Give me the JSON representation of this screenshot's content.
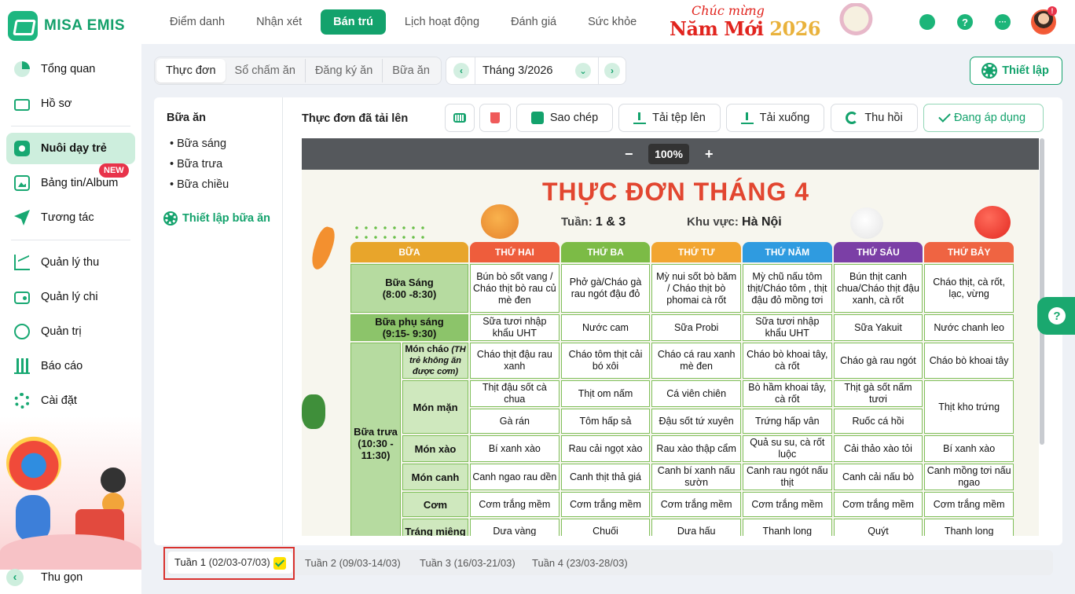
{
  "app": {
    "logo_text": "MISA EMIS"
  },
  "sidebar": {
    "items": [
      {
        "label": "Tổng quan",
        "icon": "pie-chart-icon"
      },
      {
        "label": "Hồ sơ",
        "icon": "folder-icon"
      },
      {
        "label": "Nuôi dạy trẻ",
        "icon": "house-icon",
        "active": true
      },
      {
        "label": "Bảng tin/Album",
        "icon": "image-icon",
        "badge": "NEW"
      },
      {
        "label": "Tương tác",
        "icon": "send-icon"
      },
      {
        "label": "Quản lý thu",
        "icon": "trend-chart-icon"
      },
      {
        "label": "Quản lý chi",
        "icon": "wallet-icon"
      },
      {
        "label": "Quản trị",
        "icon": "admin-icon"
      },
      {
        "label": "Báo cáo",
        "icon": "bar-chart-icon"
      },
      {
        "label": "Cài đặt",
        "icon": "gear-icon"
      }
    ],
    "collapse_label": "Thu gọn"
  },
  "topnav": {
    "tabs": [
      "Điểm danh",
      "Nhận xét",
      "Bán trú",
      "Lịch hoạt động",
      "Đánh giá",
      "Sức khỏe"
    ],
    "active_tab": "Bán trú",
    "banner_line1": "Chúc mừng",
    "banner_line2a": "Năm Mới ",
    "banner_line2b": "2026",
    "help_icon_text": "?",
    "more_icon_text": "···",
    "avatar_badge": "!"
  },
  "subtabs": [
    "Thực đơn",
    "Sổ chấm ăn",
    "Đăng ký ăn",
    "Bữa ăn"
  ],
  "month_picker": {
    "value": "Tháng 3/2026",
    "prev": "‹",
    "next": "›",
    "dropdown": "⌄"
  },
  "setup_button": "Thiết lập",
  "left_panel": {
    "title": "Bữa ăn",
    "items": [
      "• Bữa sáng",
      "• Bữa trưa",
      "• Bữa chiều"
    ],
    "setup_link": "Thiết lập bữa ăn"
  },
  "toolbar": {
    "title": "Thực đơn đã tải lên",
    "copy": "Sao chép",
    "upload": "Tải tệp lên",
    "download": "Tải xuống",
    "revoke": "Thu hồi",
    "applying": "Đang áp dụng"
  },
  "viewer": {
    "zoom": "100%",
    "minus": "−",
    "plus": "+"
  },
  "menu": {
    "title": "THỰC ĐƠN THÁNG 4",
    "week_label": "Tuần:",
    "week_value": "1 & 3",
    "area_label": "Khu vực:",
    "area_value": "Hà Nội",
    "headers": [
      "BỮA",
      "THỨ HAI",
      "THỨ BA",
      "THỨ TƯ",
      "THỨ NĂM",
      "THỨ SÁU",
      "THỨ BẢY"
    ],
    "header_colors": [
      "#e8a52b",
      "#ee5d3c",
      "#7cbb46",
      "#f2a530",
      "#2f9be0",
      "#7b3fa6",
      "#ef6442"
    ],
    "breakfast": {
      "label": "Bữa Sáng\n(8:00 -8:30)",
      "items": [
        "Bún bò sốt vang / Cháo thịt bò rau củ mè đen",
        "Phở gà/Cháo gà rau ngót đậu đỏ",
        "Mỳ nui sốt bò băm / Cháo thịt bò phomai cà rốt",
        "Mỳ chũ nấu tôm thịt/Cháo tôm , thịt đậu đỏ mồng tơi",
        "Bún thịt canh chua/Cháo thịt đậu xanh, cà rốt",
        "Cháo thịt, cà rốt, lạc, vừng"
      ]
    },
    "snack": {
      "label": "Bữa phụ sáng\n(9:15- 9:30)",
      "items": [
        "Sữa tươi nhập khẩu UHT",
        "Nước cam",
        "Sữa Probi",
        "Sữa tươi nhập khẩu UHT",
        "Sữa Yakuit",
        "Nước chanh leo"
      ]
    },
    "lunch": {
      "label": "Bữa trưa\n(10:30 -\n11:30)",
      "porridge": {
        "label": "Món cháo",
        "note": " (TH trẻ không ăn được cơm)",
        "items": [
          "Cháo thịt đậu rau xanh",
          "Cháo tôm thịt cải bó xôi",
          "Cháo cá rau xanh mè đen",
          "Cháo bò khoai tây, cà rốt",
          "Cháo gà rau ngót",
          "Cháo bò khoai tây"
        ]
      },
      "savory": {
        "label": "Món mặn",
        "row1": [
          "Thịt đậu sốt cà chua",
          "Thịt om nấm",
          "Cá viên chiên",
          "Bò hầm khoai tây, cà rốt",
          "Thịt gà sốt nấm tươi"
        ],
        "row2": [
          "Gà rán",
          "Tôm hấp sả",
          "Đậu sốt tứ xuyên",
          "Trứng hấp vân",
          "Ruốc cá hồi"
        ],
        "sat": "Thịt kho trứng"
      },
      "stirfry": {
        "label": "Món xào",
        "items": [
          "Bí xanh xào",
          "Rau cải ngọt xào",
          "Rau xào thập cẩm",
          "Quả su su, cà rốt luộc",
          "Cải thảo xào tỏi",
          "Bí xanh xào"
        ]
      },
      "soup": {
        "label": "Món canh",
        "items": [
          "Canh ngao rau dền",
          "Canh thịt thả giá",
          "Canh bí xanh nấu sườn",
          "Canh rau ngót nấu thịt",
          "Canh cải nấu bò",
          "Canh mồng tơi nấu ngao"
        ]
      },
      "rice": {
        "label": "Cơm",
        "items": [
          "Cơm trắng mềm",
          "Cơm trắng mềm",
          "Cơm trắng mềm",
          "Cơm trắng mềm",
          "Cơm trắng mềm",
          "Cơm trắng mềm"
        ]
      },
      "dessert": {
        "label": "Tráng miệng",
        "items": [
          "Dưa vàng",
          "Chuối",
          "Dưa hấu",
          "Thanh long",
          "Quýt",
          "Thanh long"
        ]
      }
    }
  },
  "weeks": [
    {
      "label": "Tuần 1",
      "range": " (02/03-07/03)",
      "active": true
    },
    {
      "label": "Tuần 2",
      "range": " (09/03-14/03)"
    },
    {
      "label": "Tuần 3",
      "range": " (16/03-21/03)"
    },
    {
      "label": "Tuần 4",
      "range": " (23/03-28/03)"
    }
  ],
  "help_float": "?",
  "colors": {
    "brand": "#13a26c",
    "danger": "#e8334a"
  }
}
